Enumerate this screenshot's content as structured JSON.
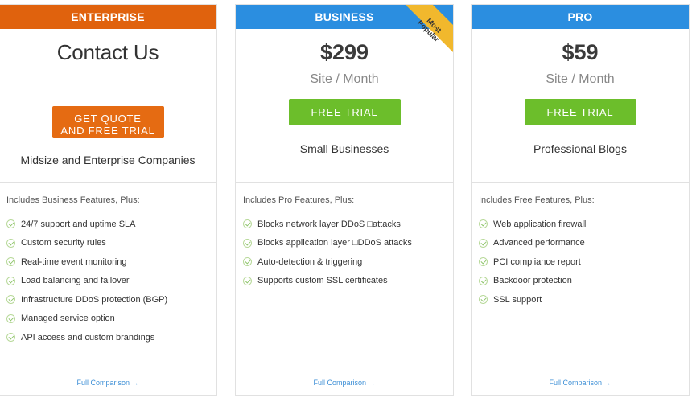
{
  "colors": {
    "enterprise_header": "#e0620d",
    "business_header": "#2b8ee0",
    "pro_header": "#2b8ee0",
    "green_button": "#6cbe2b",
    "orange_button": "#e56b12",
    "link": "#3d8fd6",
    "ribbon": "#f1b82d"
  },
  "plans": {
    "enterprise": {
      "name": "ENTERPRISE",
      "headline": "Contact Us",
      "cta": "GET QUOTE\nAND FREE TRIAL",
      "audience": "Midsize and Enterprise Companies",
      "features_title": "Includes Business Features, Plus:",
      "features": [
        "24/7 support and uptime SLA",
        "Custom security rules",
        "Real-time event monitoring",
        "Load balancing and failover",
        "Infrastructure DDoS protection (BGP)",
        "Managed service option",
        "API access and custom brandings"
      ],
      "link": "Full Comparison →"
    },
    "business": {
      "name": "BUSINESS",
      "price": "$299",
      "period": "Site / Month",
      "ribbon": "Most\nPopular",
      "cta": "FREE TRIAL",
      "audience": "Small Businesses",
      "features_title": "Includes Pro Features, Plus:",
      "features": [
        "Blocks network layer DDoS □attacks",
        "Blocks application layer □DDoS attacks",
        "Auto-detection & triggering",
        "Supports custom SSL certificates"
      ],
      "link": "Full Comparison →"
    },
    "pro": {
      "name": "PRO",
      "price": "$59",
      "period": "Site / Month",
      "cta": "FREE TRIAL",
      "audience": "Professional Blogs",
      "features_title": "Includes Free Features, Plus:",
      "features": [
        "Web application firewall",
        "Advanced performance",
        "PCI compliance report",
        "Backdoor protection",
        "SSL support"
      ],
      "link": "Full Comparison →"
    }
  }
}
